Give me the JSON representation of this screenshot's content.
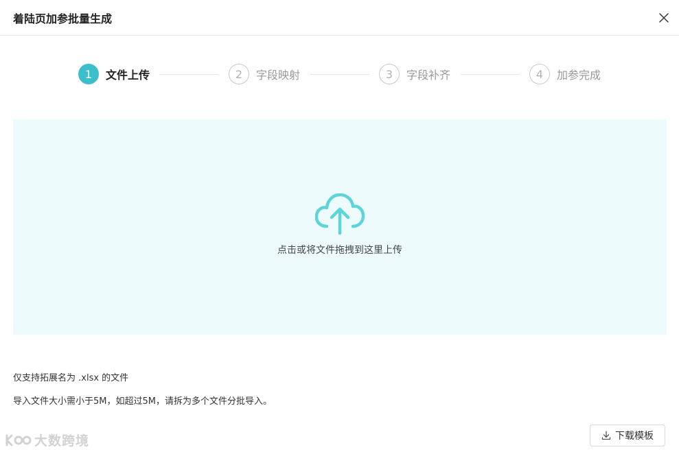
{
  "dialog": {
    "title": "着陆页加参批量生成",
    "close_icon": "close-icon"
  },
  "steps": [
    {
      "number": "1",
      "label": "文件上传",
      "active": true
    },
    {
      "number": "2",
      "label": "字段映射",
      "active": false
    },
    {
      "number": "3",
      "label": "字段补齐",
      "active": false
    },
    {
      "number": "4",
      "label": "加参完成",
      "active": false
    }
  ],
  "upload": {
    "icon": "cloud-upload-icon",
    "text": "点击或将文件拖拽到这里上传"
  },
  "hints": {
    "extension": "仅支持拓展名为 .xlsx 的文件",
    "size": "导入文件大小需小于5M，如超过5M，请拆为多个文件分批导入。"
  },
  "actions": {
    "download_template": "下载模板",
    "download_icon": "download-icon"
  },
  "watermark": {
    "text": "大数跨境"
  },
  "colors": {
    "accent": "#3dbfcb",
    "icon": "#5dd5d8",
    "dropzone_bg": "#eefbfc"
  }
}
